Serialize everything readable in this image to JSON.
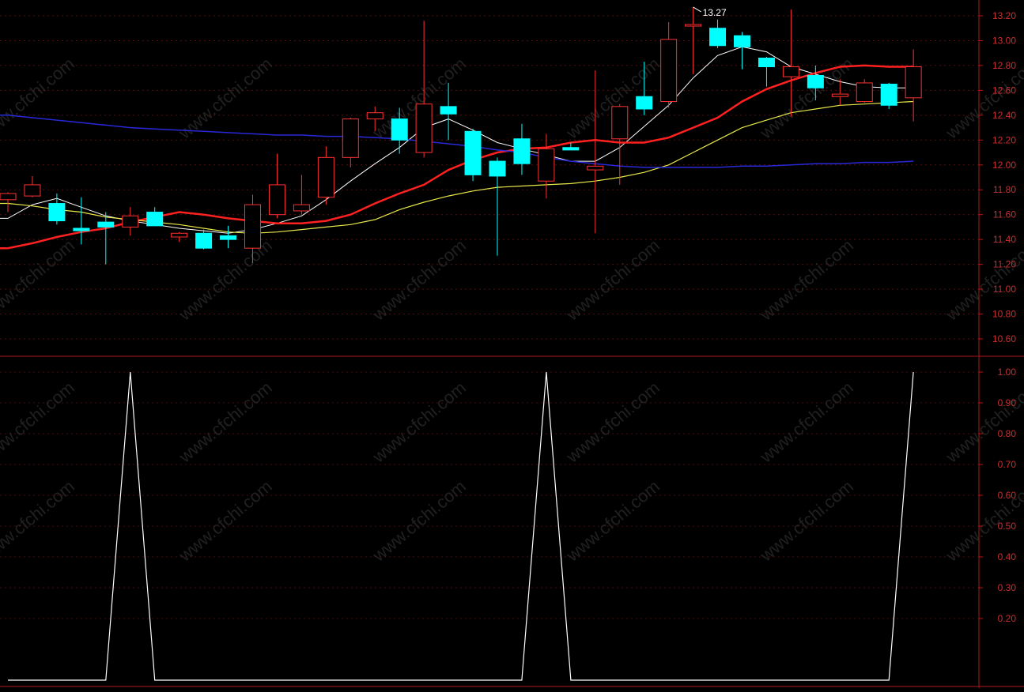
{
  "chart_data": [
    {
      "type": "candlestick",
      "panel": "price",
      "y_axis_side": "right",
      "y_ticks": [
        "13.20",
        "13.00",
        "12.80",
        "12.60",
        "12.40",
        "12.20",
        "12.00",
        "11.80",
        "11.60",
        "11.40",
        "11.20",
        "11.00",
        "10.80",
        "10.60"
      ],
      "ylim": [
        10.5,
        13.27
      ],
      "high_annotation": "13.27",
      "candles": [
        {
          "o": 11.72,
          "h": 11.78,
          "l": 11.62,
          "c": 11.77
        },
        {
          "o": 11.75,
          "h": 11.91,
          "l": 11.74,
          "c": 11.84
        },
        {
          "o": 11.69,
          "h": 11.77,
          "l": 11.52,
          "c": 11.55
        },
        {
          "o": 11.49,
          "h": 11.74,
          "l": 11.36,
          "c": 11.47
        },
        {
          "o": 11.54,
          "h": 11.62,
          "l": 11.2,
          "c": 11.5
        },
        {
          "o": 11.5,
          "h": 11.66,
          "l": 11.43,
          "c": 11.59
        },
        {
          "o": 11.62,
          "h": 11.66,
          "l": 11.51,
          "c": 11.51
        },
        {
          "o": 11.42,
          "h": 11.46,
          "l": 11.38,
          "c": 11.45
        },
        {
          "o": 11.45,
          "h": 11.48,
          "l": 11.32,
          "c": 11.33
        },
        {
          "o": 11.43,
          "h": 11.51,
          "l": 11.33,
          "c": 11.4
        },
        {
          "o": 11.33,
          "h": 11.76,
          "l": 11.21,
          "c": 11.68
        },
        {
          "o": 11.6,
          "h": 12.09,
          "l": 11.57,
          "c": 11.84
        },
        {
          "o": 11.63,
          "h": 11.92,
          "l": 11.6,
          "c": 11.68
        },
        {
          "o": 11.74,
          "h": 12.15,
          "l": 11.68,
          "c": 12.06
        },
        {
          "o": 12.06,
          "h": 12.38,
          "l": 11.98,
          "c": 12.37
        },
        {
          "o": 12.37,
          "h": 12.47,
          "l": 12.27,
          "c": 12.42
        },
        {
          "o": 12.37,
          "h": 12.46,
          "l": 12.09,
          "c": 12.2
        },
        {
          "o": 12.1,
          "h": 13.16,
          "l": 12.06,
          "c": 12.49
        },
        {
          "o": 12.47,
          "h": 12.66,
          "l": 12.2,
          "c": 12.41
        },
        {
          "o": 12.27,
          "h": 12.29,
          "l": 11.87,
          "c": 11.92
        },
        {
          "o": 12.03,
          "h": 12.06,
          "l": 11.27,
          "c": 11.91
        },
        {
          "o": 12.21,
          "h": 12.33,
          "l": 11.92,
          "c": 12.01
        },
        {
          "o": 11.87,
          "h": 12.25,
          "l": 11.73,
          "c": 12.13
        },
        {
          "o": 12.14,
          "h": 12.18,
          "l": 12.12,
          "c": 12.12
        },
        {
          "o": 11.96,
          "h": 12.76,
          "l": 11.45,
          "c": 11.99
        },
        {
          "o": 12.21,
          "h": 12.49,
          "l": 11.84,
          "c": 12.47
        },
        {
          "o": 12.55,
          "h": 12.83,
          "l": 12.4,
          "c": 12.45
        },
        {
          "o": 12.51,
          "h": 13.15,
          "l": 12.46,
          "c": 13.01
        },
        {
          "o": 13.13,
          "h": 13.27,
          "l": 12.73,
          "c": 13.13
        },
        {
          "o": 13.1,
          "h": 13.17,
          "l": 12.94,
          "c": 12.96
        },
        {
          "o": 13.04,
          "h": 13.07,
          "l": 12.77,
          "c": 12.95
        },
        {
          "o": 12.86,
          "h": 12.87,
          "l": 12.63,
          "c": 12.79
        },
        {
          "o": 12.71,
          "h": 13.25,
          "l": 12.39,
          "c": 12.79
        },
        {
          "o": 12.72,
          "h": 12.8,
          "l": 12.52,
          "c": 12.62
        },
        {
          "o": 12.55,
          "h": 12.69,
          "l": 12.48,
          "c": 12.57
        },
        {
          "o": 12.51,
          "h": 12.69,
          "l": 12.5,
          "c": 12.66
        },
        {
          "o": 12.65,
          "h": 12.66,
          "l": 12.45,
          "c": 12.48
        },
        {
          "o": 12.54,
          "h": 12.93,
          "l": 12.35,
          "c": 12.79
        }
      ],
      "series": [
        {
          "color": "#ffffff",
          "values": [
            11.57,
            11.68,
            11.73,
            11.66,
            11.59,
            11.55,
            11.52,
            11.49,
            11.47,
            11.45,
            11.48,
            11.53,
            11.59,
            11.72,
            11.87,
            12.01,
            12.14,
            12.3,
            12.37,
            12.28,
            12.18,
            12.13,
            12.08,
            12.03,
            12.03,
            12.14,
            12.31,
            12.48,
            12.7,
            12.88,
            12.95,
            12.91,
            12.79,
            12.73,
            12.67,
            12.63,
            12.62,
            12.62
          ]
        },
        {
          "color": "#ff2020",
          "values": [
            11.33,
            11.37,
            11.42,
            11.46,
            11.49,
            11.54,
            11.58,
            11.62,
            11.6,
            11.57,
            11.55,
            11.53,
            11.53,
            11.55,
            11.6,
            11.69,
            11.77,
            11.84,
            11.96,
            12.04,
            12.1,
            12.13,
            12.14,
            12.18,
            12.2,
            12.18,
            12.18,
            12.22,
            12.3,
            12.38,
            12.51,
            12.61,
            12.68,
            12.74,
            12.79,
            12.8,
            12.79,
            12.79
          ]
        },
        {
          "color": "#e8e84a",
          "values": [
            11.69,
            11.67,
            11.64,
            11.62,
            11.58,
            11.56,
            11.54,
            11.52,
            11.49,
            11.46,
            11.45,
            11.46,
            11.48,
            11.5,
            11.52,
            11.56,
            11.64,
            11.7,
            11.75,
            11.79,
            11.82,
            11.83,
            11.84,
            11.85,
            11.87,
            11.9,
            11.94,
            12.0,
            12.1,
            12.2,
            12.3,
            12.36,
            12.42,
            12.45,
            12.48,
            12.49,
            12.5,
            12.51
          ]
        },
        {
          "color": "#2828d8",
          "values": [
            12.4,
            12.38,
            12.36,
            12.34,
            12.32,
            12.3,
            12.29,
            12.28,
            12.27,
            12.26,
            12.25,
            12.24,
            12.24,
            12.23,
            12.23,
            12.22,
            12.21,
            12.19,
            12.17,
            12.15,
            12.12,
            12.1,
            12.06,
            12.03,
            12.01,
            11.99,
            11.98,
            11.98,
            11.98,
            11.98,
            11.99,
            11.99,
            12.0,
            12.01,
            12.01,
            12.02,
            12.02,
            12.03
          ]
        }
      ]
    },
    {
      "type": "line",
      "panel": "indicator",
      "y_axis_side": "right",
      "y_ticks": [
        "1.00",
        "0.90",
        "0.80",
        "0.70",
        "0.60",
        "0.50",
        "0.40",
        "0.30",
        "0.20"
      ],
      "ylim": [
        0,
        1
      ],
      "series": [
        {
          "color": "#ffffff",
          "values": [
            0,
            0,
            0,
            0,
            0,
            1,
            0,
            0,
            0,
            0,
            0,
            0,
            0,
            0,
            0,
            0,
            0,
            0,
            0,
            0,
            0,
            0,
            1,
            0,
            0,
            0,
            0,
            0,
            0,
            0,
            0,
            0,
            0,
            0,
            0,
            0,
            0,
            1
          ]
        }
      ]
    }
  ],
  "watermark": "www.cfchi.com"
}
